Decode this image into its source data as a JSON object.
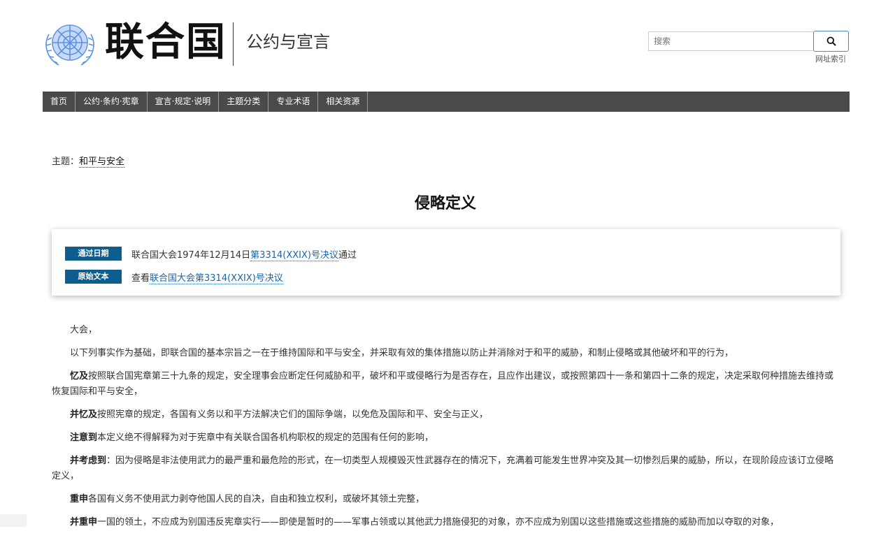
{
  "header": {
    "brand": "联合国",
    "subbrand": "公约与宣言",
    "search_placeholder": "搜索",
    "site_index": "网址索引"
  },
  "nav": [
    {
      "label": "首页"
    },
    {
      "label": "公约·条约·宪章"
    },
    {
      "label": "宣言·规定·说明"
    },
    {
      "label": "主题分类"
    },
    {
      "label": "专业术语"
    },
    {
      "label": "相关资源"
    }
  ],
  "topic": {
    "prefix": "主题：",
    "link": "和平与安全"
  },
  "title": "侵略定义",
  "info": {
    "adopted_badge": "通过日期",
    "adopted_prefix": "联合国大会1974年12月14日",
    "adopted_link": "第3314(XXIX)号决议",
    "adopted_suffix": "通过",
    "source_badge": "原始文本",
    "source_prefix": "查看",
    "source_link": "联合国大会第3314(XXIX)号决议"
  },
  "body": {
    "p0": "大会，",
    "p1": "以下列事实作为基础，即联合国的基本宗旨之一在于维持国际和平与安全，并采取有效的集体措施以防止并消除对于和平的威胁，和制止侵略或其他破坏和平的行为，",
    "p2_lead": "忆及",
    "p2": "按照联合国宪章第三十九条的规定，安全理事会应断定任何威胁和平，破坏和平或侵略行为是否存在，且应作出建议，或按照第四十一条和第四十二条的规定，决定采取何种措施去维持或恢复国际和平与安全，",
    "p3_lead": "并忆及",
    "p3": "按照宪章的规定，各国有义务以和平方法解决它们的国际争端，以免危及国际和平、安全与正义，",
    "p4_lead": "注意到",
    "p4": "本定义绝不得解释为对于宪章中有关联合国各机构职权的规定的范围有任何的影响，",
    "p5_lead": "并考虑到",
    "p5": "：因为侵略是非法使用武力的最严重和最危险的形式，在一切类型人规模毁灭性武器存在的情况下，充满着可能发生世界冲突及其一切惨烈后果的威胁，所以，在现阶段应该订立侵略定义，",
    "p6_lead": "重申",
    "p6": "各国有义务不使用武力剥夺他国人民的自决，自由和独立权利，或破坏其领土完整，",
    "p7_lead": "并重申",
    "p7": "一国的领土，不应成为别国违反宪章实行——即使是暂时的——军事占领或以其他武力措施侵犯的对象，亦不应成为别国以这些措施或这些措施的威胁而加以夺取的对象，"
  },
  "colors": {
    "nav_bg": "#4a4a4a",
    "badge_bg": "#0d5d8f",
    "link": "#1a64a8",
    "logo": "#5b92e5"
  },
  "icons": {
    "logo": "un-emblem-icon",
    "search": "search-icon"
  }
}
